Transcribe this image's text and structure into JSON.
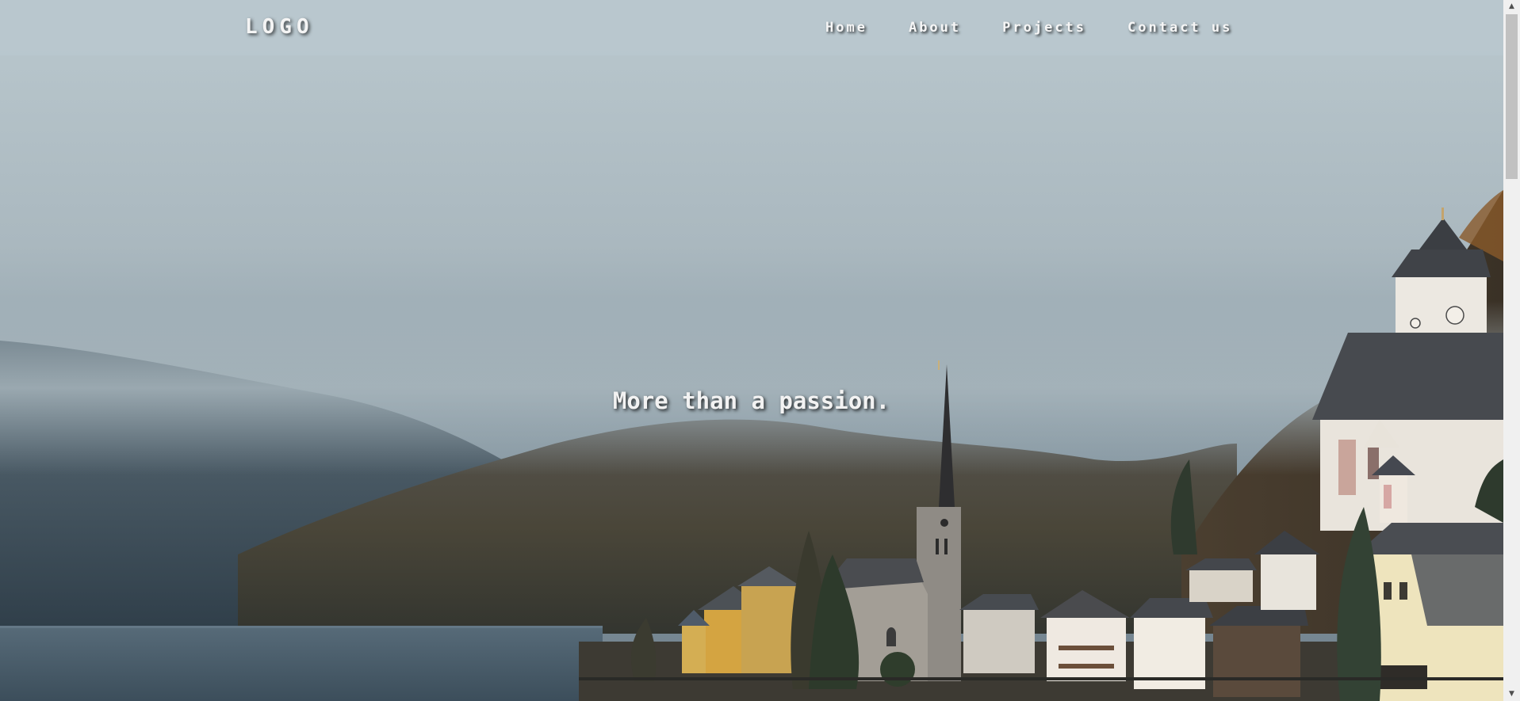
{
  "header": {
    "logo": "LOGO",
    "nav": [
      {
        "label": "Home"
      },
      {
        "label": "About"
      },
      {
        "label": "Projects"
      },
      {
        "label": "Contact us"
      }
    ]
  },
  "hero": {
    "tagline": "More than a passion.",
    "background_image": "foggy-lakeside-village-with-church-spire"
  },
  "colors": {
    "navbar": "#b9c7ce",
    "text": "#f4f4f4",
    "sky": "#a9b8c0",
    "mountain": "#3b4a55",
    "lake": "#4a5f6e"
  },
  "scrollbar": {
    "up_icon": "triangle-up-icon",
    "down_icon": "triangle-down-icon"
  }
}
